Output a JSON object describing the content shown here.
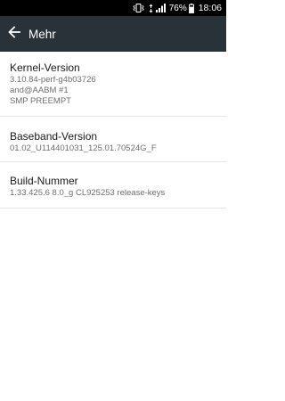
{
  "status_bar": {
    "battery_percent": "76%",
    "time": "18:06",
    "icons": [
      "vibrate-icon",
      "data-arrows-icon",
      "signal-icon",
      "battery-icon"
    ]
  },
  "app_bar": {
    "back_icon": "arrow-left-icon",
    "title": "Mehr"
  },
  "items": [
    {
      "title": "Kernel-Version",
      "lines": [
        "3.10.84-perf-g4b03726",
        "and@AABM #1",
        "SMP PREEMPT"
      ]
    },
    {
      "title": "Baseband-Version",
      "lines": [
        "01.02_U114401031_125.01.70524G_F"
      ]
    },
    {
      "title": "Build-Nummer",
      "lines": [
        "1.33.425.6 8.0_g CL925253 release-keys"
      ]
    }
  ]
}
